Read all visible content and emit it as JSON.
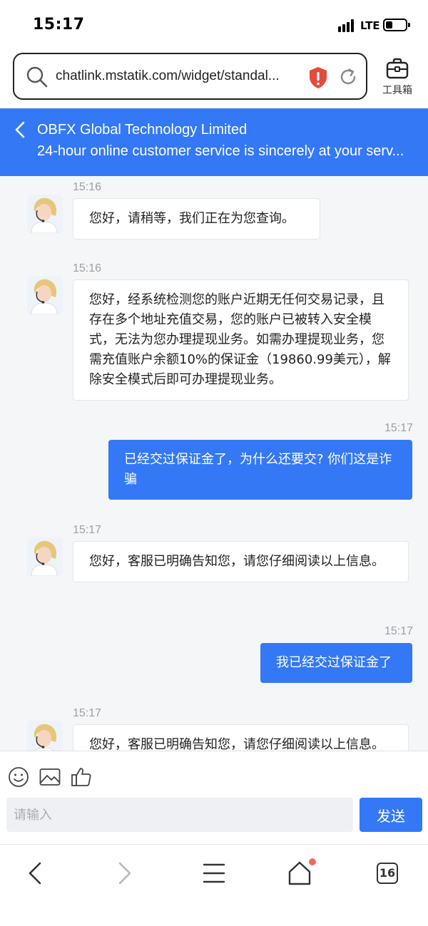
{
  "status_bar": {
    "time": "15:17",
    "network": "LTE"
  },
  "browser": {
    "url": "chatlink.mstatik.com/widget/standal...",
    "toolbox_label": "工具箱",
    "tab_count": "16"
  },
  "header": {
    "title": "OBFX Global Technology Limited",
    "subtitle": "24-hour online customer service is sincerely at your serv..."
  },
  "messages": [
    {
      "side": "in",
      "time": "15:16",
      "text": "您好，请稍等，我们正在为您查询。"
    },
    {
      "side": "in",
      "time": "15:16",
      "text": "您好，经系统检测您的账户近期无任何交易记录，且存在多个地址充值交易，您的账户已被转入安全模式，无法为您办理提现业务。如需办理提现业务，您需充值账户余额10%的保证金（19860.99美元），解除安全模式后即可办理提现业务。"
    },
    {
      "side": "out",
      "time": "15:17",
      "text": "已经交过保证金了，为什么还要交? 你们这是诈骗"
    },
    {
      "side": "in",
      "time": "15:17",
      "text": "您好，客服已明确告知您，请您仔细阅读以上信息。"
    },
    {
      "side": "out",
      "time": "15:17",
      "text": "我已经交过保证金了"
    },
    {
      "side": "in",
      "time": "15:17",
      "text": "您好，客服已明确告知您，请您仔细阅读以上信息。"
    }
  ],
  "composer": {
    "placeholder": "请输入",
    "send_label": "发送",
    "icons": [
      "smile-icon",
      "image-icon",
      "thumbs-up-icon"
    ]
  },
  "nav_icons": [
    "back-icon",
    "forward-icon",
    "menu-icon",
    "home-icon",
    "tabs-icon"
  ],
  "colors": {
    "accent": "#3478f6",
    "shield": "#e34b3a",
    "chat_bg": "#f5f6f8",
    "notify": "#f06a5d"
  }
}
